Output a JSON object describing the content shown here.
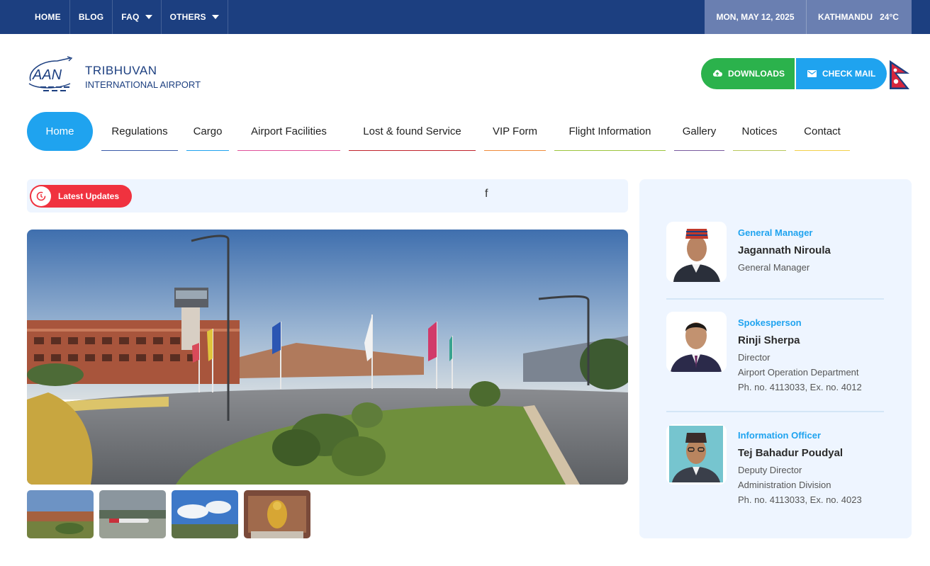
{
  "topbar": {
    "nav": [
      {
        "label": "HOME"
      },
      {
        "label": "BLOG"
      },
      {
        "label": "FAQ",
        "dropdown": true
      },
      {
        "label": "OTHERS",
        "dropdown": true
      }
    ],
    "date": "MON, MAY 12, 2025",
    "location": "KATHMANDU",
    "temperature": "24°C"
  },
  "logo": {
    "mark_text": "AAN",
    "line1": "TRIBHUVAN",
    "line2": "INTERNATIONAL AIRPORT"
  },
  "header_buttons": {
    "downloads": "DOWNLOADS",
    "check_mail": "CHECK MAIL"
  },
  "main_nav": {
    "home": "Home",
    "items": [
      {
        "label": "Regulations",
        "underline": "#3a5ba8"
      },
      {
        "label": "Cargo",
        "underline": "#1fa3ef"
      },
      {
        "label": "Airport Facilities",
        "underline": "#e0519a"
      },
      {
        "label": "Lost & found Service",
        "underline": "#c0232b"
      },
      {
        "label": "VIP Form",
        "underline": "#f08a3a"
      },
      {
        "label": "Flight Information",
        "underline": "#9bc53d"
      },
      {
        "label": "Gallery",
        "underline": "#7a5a9e"
      },
      {
        "label": "Notices",
        "underline": "#b8c85a"
      },
      {
        "label": "Contact",
        "underline": "#f2d04a"
      }
    ]
  },
  "updates": {
    "badge": "Latest Updates",
    "ticker": "f"
  },
  "officials": [
    {
      "role": "General Manager",
      "name": "Jagannath Niroula",
      "lines": [
        "General Manager"
      ]
    },
    {
      "role": "Spokesperson",
      "name": "Rinji Sherpa",
      "lines": [
        "Director",
        "Airport Operation Department",
        "Ph. no. 4113033, Ex. no. 4012"
      ]
    },
    {
      "role": "Information Officer",
      "name": "Tej Bahadur Poudyal",
      "lines": [
        "Deputy Director",
        "Administration Division",
        "Ph. no. 4113033, Ex. no. 4023"
      ]
    }
  ],
  "colors": {
    "topbar": "#1c3f80",
    "accent_blue": "#1fa3ef",
    "accent_green": "#2bb24c",
    "badge_red": "#f0323f"
  }
}
